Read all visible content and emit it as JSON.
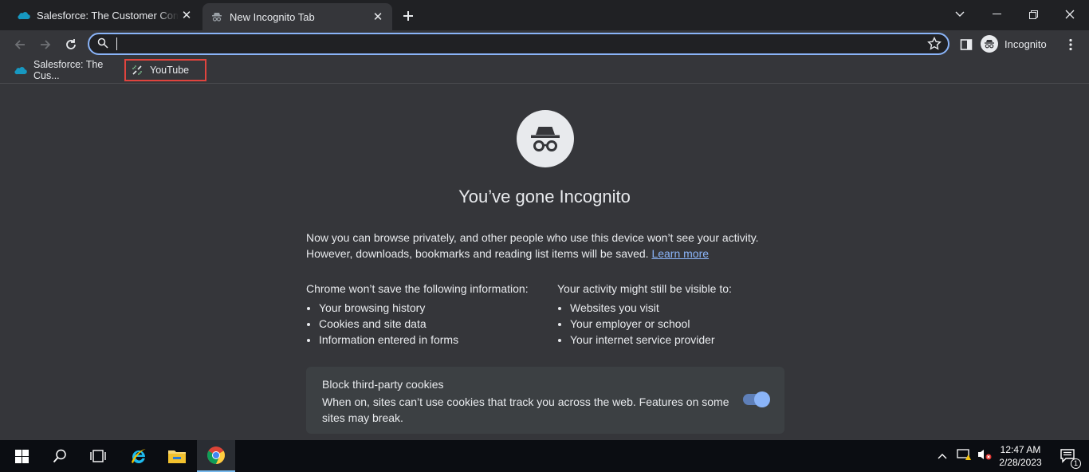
{
  "tabs": [
    {
      "title": "Salesforce: The Customer Company",
      "favicon": "salesforce-cloud-icon",
      "active": false
    },
    {
      "title": "New Incognito Tab",
      "favicon": "incognito-icon",
      "active": true
    }
  ],
  "window_controls": {
    "tab_search": "chevron-down-icon",
    "minimize": "minimize-icon",
    "restore": "restore-icon",
    "close": "close-icon"
  },
  "toolbar": {
    "omnibox_value": "",
    "profile_label": "Incognito"
  },
  "bookmarks": [
    {
      "label": "Salesforce: The Cus...",
      "icon": "salesforce-cloud-icon"
    },
    {
      "label": "YouTube",
      "icon": "broken-link-icon"
    }
  ],
  "page": {
    "heading": "You’ve gone Incognito",
    "intro_text": "Now you can browse privately, and other people who use this device won’t see your activity. However, downloads, bookmarks and reading list items will be saved.",
    "learn_more": "Learn more",
    "left_heading": "Chrome won’t save the following information:",
    "left_items": [
      "Your browsing history",
      "Cookies and site data",
      "Information entered in forms"
    ],
    "right_heading": "Your activity might still be visible to:",
    "right_items": [
      "Websites you visit",
      "Your employer or school",
      "Your internet service provider"
    ],
    "cookie_title": "Block third-party cookies",
    "cookie_desc": "When on, sites can’t use cookies that track you across the web. Features on some sites may break.",
    "cookie_toggle_on": true
  },
  "taskbar": {
    "time": "12:47 AM",
    "date": "2/28/2023",
    "notification_count": "1"
  },
  "colors": {
    "accent": "#8ab4f8",
    "highlight_box": "#e0443e",
    "background": "#35363a"
  }
}
